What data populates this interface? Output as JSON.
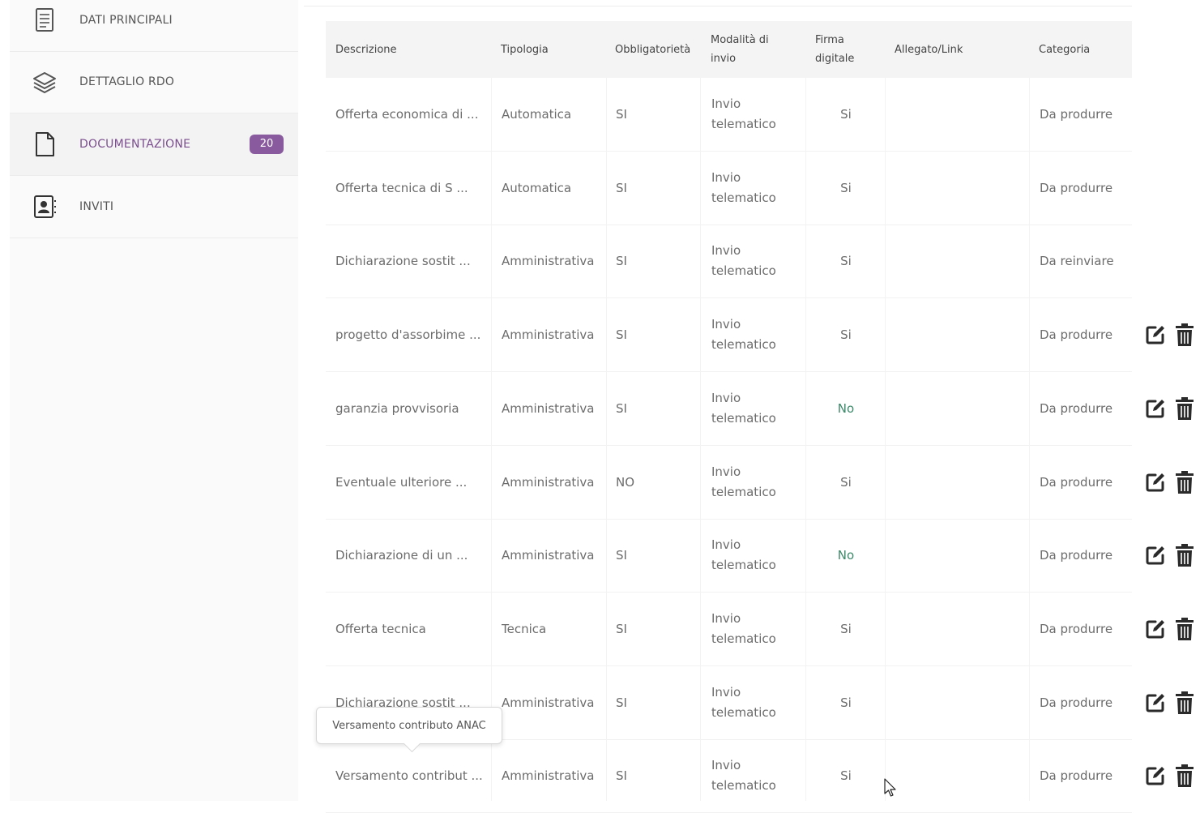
{
  "sidebar": {
    "items": [
      {
        "label": "DATI PRINCIPALI",
        "icon": "list-document-icon"
      },
      {
        "label": "DETTAGLIO RDO",
        "icon": "layers-icon"
      },
      {
        "label": "DOCUMENTAZIONE",
        "icon": "document-icon",
        "badge": "20",
        "active": true
      },
      {
        "label": "INVITI",
        "icon": "contact-card-icon"
      }
    ]
  },
  "table": {
    "headers": [
      "Descrizione",
      "Tipologia",
      "Obbligatorietà",
      "Modalità di invio",
      "Firma digitale",
      "Allegato/Link",
      "Categoria"
    ],
    "rows": [
      {
        "descrizione": "Offerta economica di ...",
        "tipologia": "Automatica",
        "obbl": "SI",
        "modalita": "Invio telematico",
        "firma": "Si",
        "categoria": "Da produrre",
        "actions": false
      },
      {
        "descrizione": "Offerta tecnica di S ...",
        "tipologia": "Automatica",
        "obbl": "SI",
        "modalita": "Invio telematico",
        "firma": "Si",
        "categoria": "Da produrre",
        "actions": false
      },
      {
        "descrizione": "Dichiarazione sostit ...",
        "tipologia": "Amministrativa",
        "obbl": "SI",
        "modalita": "Invio telematico",
        "firma": "Si",
        "categoria": "Da reinviare",
        "actions": false
      },
      {
        "descrizione": "progetto d'assorbime ...",
        "tipologia": "Amministrativa",
        "obbl": "SI",
        "modalita": "Invio telematico",
        "firma": "Si",
        "categoria": "Da produrre",
        "actions": true
      },
      {
        "descrizione": "garanzia provvisoria",
        "tipologia": "Amministrativa",
        "obbl": "SI",
        "modalita": "Invio telematico",
        "firma": "No",
        "categoria": "Da produrre",
        "actions": true
      },
      {
        "descrizione": "Eventuale ulteriore ...",
        "tipologia": "Amministrativa",
        "obbl": "NO",
        "modalita": "Invio telematico",
        "firma": "Si",
        "categoria": "Da produrre",
        "actions": true
      },
      {
        "descrizione": "Dichiarazione di un ...",
        "tipologia": "Amministrativa",
        "obbl": "SI",
        "modalita": "Invio telematico",
        "firma": "No",
        "categoria": "Da produrre",
        "actions": true
      },
      {
        "descrizione": "Offerta tecnica",
        "tipologia": "Tecnica",
        "obbl": "SI",
        "modalita": "Invio telematico",
        "firma": "Si",
        "categoria": "Da produrre",
        "actions": true
      },
      {
        "descrizione": "Dichiarazione sostit ...",
        "tipologia": "Amministrativa",
        "obbl": "SI",
        "modalita": "Invio telematico",
        "firma": "Si",
        "categoria": "Da produrre",
        "actions": true
      },
      {
        "descrizione": "Versamento contribut ...",
        "tipologia": "Amministrativa",
        "obbl": "SI",
        "modalita": "Invio telematico",
        "firma": "Si",
        "categoria": "Da produrre",
        "actions": true
      }
    ]
  },
  "tooltip": {
    "text": "Versamento contributo ANAC"
  },
  "colors": {
    "accent": "#8a5a9e",
    "accent_text": "#7b4d8e",
    "no_value": "#3d8a6a"
  }
}
